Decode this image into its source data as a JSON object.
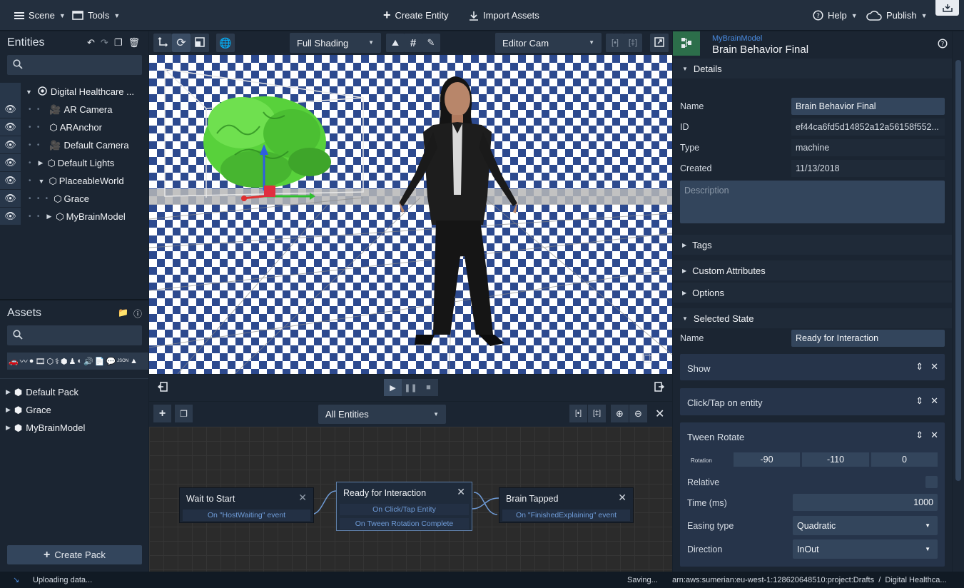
{
  "topbar": {
    "scene_label": "Scene",
    "tools_label": "Tools",
    "create_entity": "Create Entity",
    "import_assets": "Import Assets",
    "help_label": "Help",
    "publish_label": "Publish"
  },
  "entities": {
    "title": "Entities",
    "search_placeholder": "",
    "items": [
      {
        "label": "Digital Healthcare ..."
      },
      {
        "label": "AR Camera"
      },
      {
        "label": "ARAnchor"
      },
      {
        "label": "Default Camera"
      },
      {
        "label": "Default Lights"
      },
      {
        "label": "PlaceableWorld"
      },
      {
        "label": "Grace"
      },
      {
        "label": "MyBrainModel"
      }
    ]
  },
  "assets": {
    "title": "Assets",
    "search_placeholder": "",
    "packs": [
      {
        "label": "Default Pack"
      },
      {
        "label": "Grace"
      },
      {
        "label": "MyBrainModel"
      }
    ],
    "create_pack": "Create Pack"
  },
  "viewport": {
    "shading": "Full Shading",
    "camera": "Editor Cam"
  },
  "graph": {
    "filter": "All Entities",
    "nodes": [
      {
        "title": "Wait to Start",
        "events": [
          "On \"HostWaiting\" event"
        ]
      },
      {
        "title": "Ready for Interaction",
        "events": [
          "On Click/Tap Entity",
          "On Tween Rotation Complete"
        ]
      },
      {
        "title": "Brain Tapped",
        "events": [
          "On \"FinishedExplaining\" event"
        ]
      }
    ]
  },
  "inspector": {
    "entity_name": "MyBrainModel",
    "title": "Brain Behavior Final",
    "details_label": "Details",
    "name_label": "Name",
    "name_value": "Brain Behavior Final",
    "id_label": "ID",
    "id_value": "ef44ca6fd5d14852a12a56158f552...",
    "type_label": "Type",
    "type_value": "machine",
    "created_label": "Created",
    "created_value": "11/13/2018",
    "description_placeholder": "Description",
    "tags_label": "Tags",
    "custom_attrs_label": "Custom Attributes",
    "options_label": "Options",
    "selected_state_label": "Selected State",
    "state_name_label": "Name",
    "state_name_value": "Ready for Interaction",
    "actions": [
      {
        "title": "Show"
      },
      {
        "title": "Click/Tap on entity"
      },
      {
        "title": "Tween Rotate"
      }
    ],
    "rotation_label": "Rotation",
    "rotation": [
      "-90",
      "-110",
      "0"
    ],
    "relative_label": "Relative",
    "time_label": "Time (ms)",
    "time_value": "1000",
    "easing_label": "Easing type",
    "easing_value": "Quadratic",
    "direction_label": "Direction",
    "direction_value": "InOut"
  },
  "status": {
    "uploading": "Uploading data...",
    "saving": "Saving...",
    "arn": "arn:aws:sumerian:eu-west-1:128620648510:project:Drafts  /  Digital Healthca..."
  },
  "colors": {
    "accent_blue": "#4a8be0",
    "brain_green": "#58d13b",
    "panel_bg": "#1b2532"
  }
}
